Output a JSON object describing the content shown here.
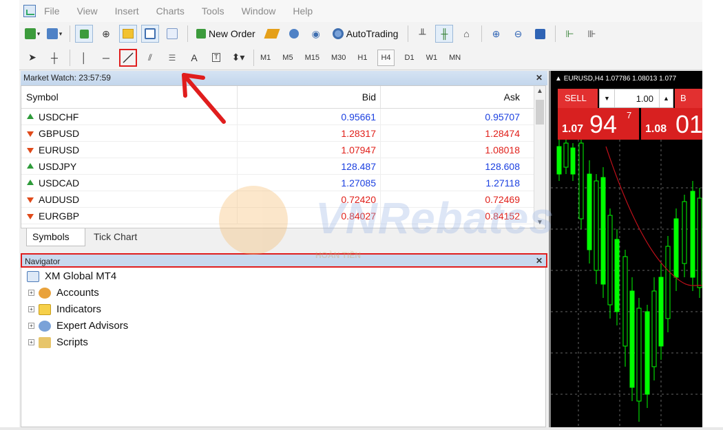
{
  "menu": [
    "File",
    "View",
    "Insert",
    "Charts",
    "Tools",
    "Window",
    "Help"
  ],
  "toolbar": {
    "new_order": "New Order",
    "autotrading": "AutoTrading"
  },
  "timeframes": [
    "M1",
    "M5",
    "M15",
    "M30",
    "H1",
    "H4",
    "D1",
    "W1",
    "MN"
  ],
  "text_tool_label": "A",
  "market_watch": {
    "title": "Market Watch: 23:57:59",
    "headers": {
      "symbol": "Symbol",
      "bid": "Bid",
      "ask": "Ask"
    },
    "rows": [
      {
        "symbol": "USDCHF",
        "bid": "0.95661",
        "ask": "0.95707",
        "dir": "up"
      },
      {
        "symbol": "GBPUSD",
        "bid": "1.28317",
        "ask": "1.28474",
        "dir": "down"
      },
      {
        "symbol": "EURUSD",
        "bid": "1.07947",
        "ask": "1.08018",
        "dir": "down"
      },
      {
        "symbol": "USDJPY",
        "bid": "128.487",
        "ask": "128.608",
        "dir": "up"
      },
      {
        "symbol": "USDCAD",
        "bid": "1.27085",
        "ask": "1.27118",
        "dir": "up"
      },
      {
        "symbol": "AUDUSD",
        "bid": "0.72420",
        "ask": "0.72469",
        "dir": "down"
      },
      {
        "symbol": "EURGBP",
        "bid": "0.84027",
        "ask": "0.84152",
        "dir": "down"
      }
    ],
    "tabs": [
      "Symbols",
      "Tick Chart"
    ]
  },
  "navigator": {
    "title": "Navigator",
    "root": "XM Global MT4",
    "items": [
      "Accounts",
      "Indicators",
      "Expert Advisors",
      "Scripts"
    ]
  },
  "chart": {
    "title": "EURUSD,H4  1.07786 1.08013 1.077",
    "sell_label": "SELL",
    "buy_label": "B",
    "lot": "1.00",
    "sell_small": "1.07",
    "sell_big": "94",
    "sell_sup": "7",
    "buy_small": "1.08",
    "buy_big": "01"
  },
  "watermark": {
    "brand": "VNRebates",
    "tagline": "HOÀN TIỀN"
  },
  "colors": {
    "bid_up": "#1a3fe0",
    "bid_down": "#e0201a",
    "highlight": "#e01d1d",
    "candle": "#00ff00",
    "ma_line": "#c0101a"
  }
}
